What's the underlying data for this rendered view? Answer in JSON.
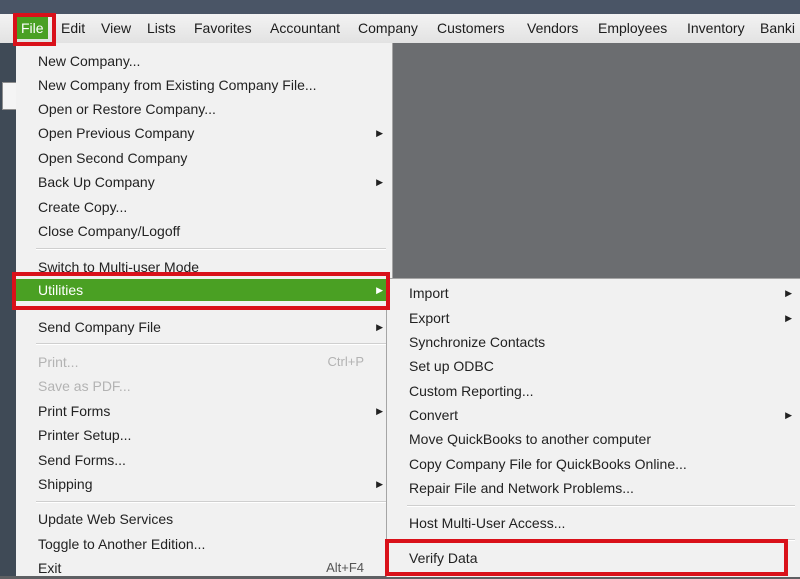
{
  "titlebar": {
    "text": ""
  },
  "menubar": {
    "items": [
      "File",
      "Edit",
      "View",
      "Lists",
      "Favorites",
      "Accountant",
      "Company",
      "Customers",
      "Vendors",
      "Employees",
      "Inventory",
      "Banki"
    ]
  },
  "file_menu": {
    "items": [
      "New Company...",
      "New Company from Existing Company File...",
      "Open or Restore Company...",
      "Open Previous Company",
      "Open Second Company",
      "Back Up Company",
      "Create Copy...",
      "Close Company/Logoff",
      "Switch to Multi-user Mode",
      "Utilities",
      "Send Company File",
      "Print...",
      "Save as PDF...",
      "Print Forms",
      "Printer Setup...",
      "Send Forms...",
      "Shipping",
      "Update Web Services",
      "Toggle to Another Edition...",
      "Exit"
    ],
    "shortcuts": {
      "print": "Ctrl+P",
      "exit": "Alt+F4"
    }
  },
  "utilities_submenu": {
    "items": [
      "Import",
      "Export",
      "Synchronize Contacts",
      "Set up ODBC",
      "Custom Reporting...",
      "Convert",
      "Move QuickBooks to another computer",
      "Copy Company File for QuickBooks Online...",
      "Repair File and Network Problems...",
      "Host Multi-User Access...",
      "Verify Data"
    ]
  },
  "colors": {
    "highlight": "#4aa023",
    "annotation_red": "#d9111a",
    "menu_background": "#f1f1f1"
  },
  "icons": {
    "submenu_arrow": "triangle-right-icon"
  }
}
